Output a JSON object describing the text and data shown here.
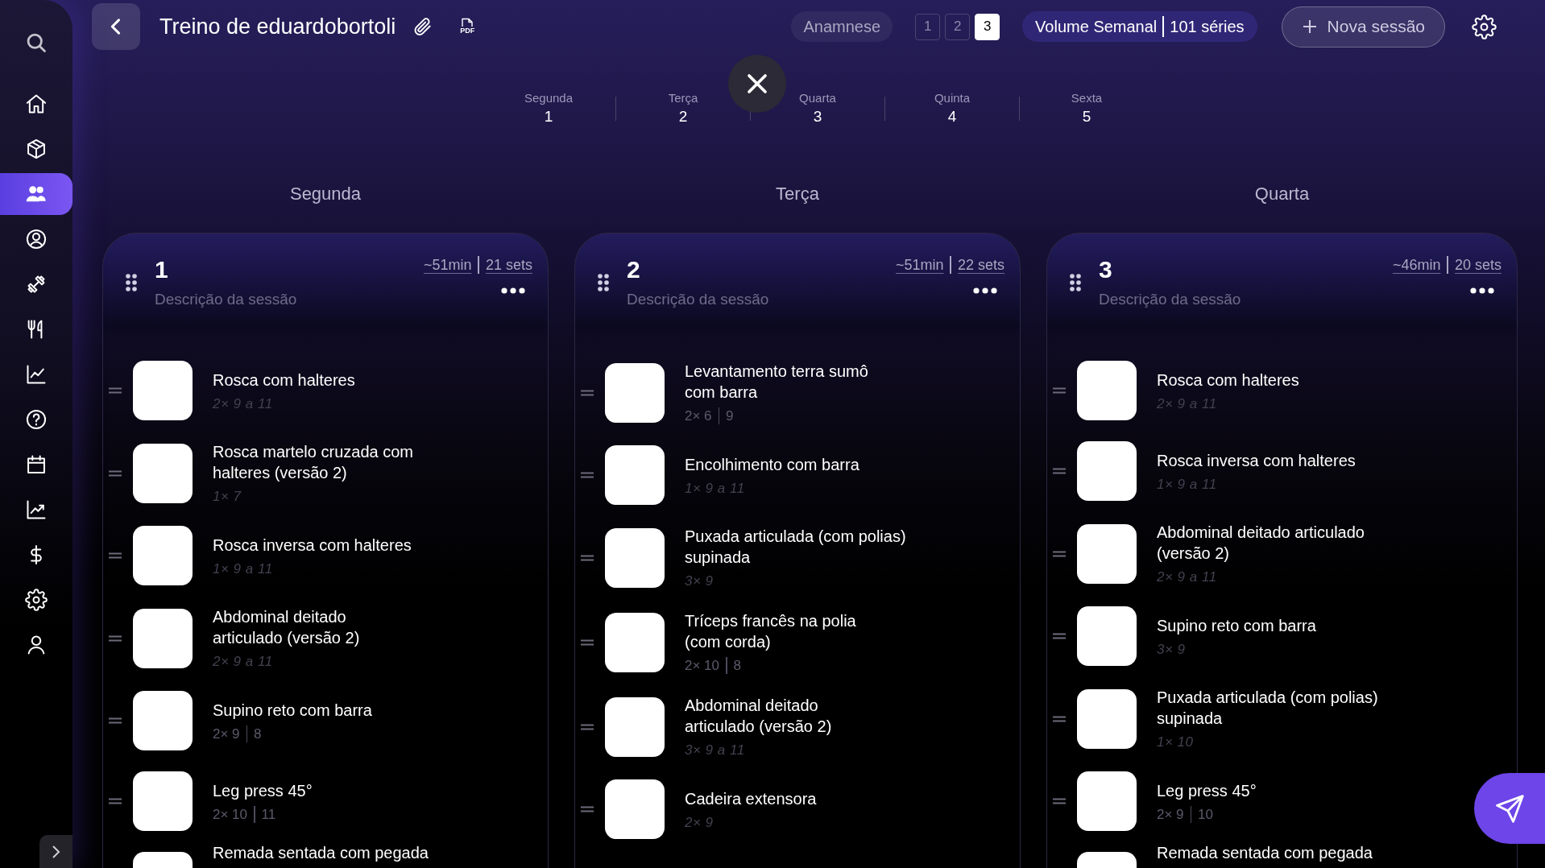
{
  "sidebar": {
    "items": [
      {
        "kind": "search",
        "selected": false
      },
      {
        "kind": "home",
        "selected": false
      },
      {
        "kind": "cube",
        "selected": false
      },
      {
        "kind": "users",
        "selected": true
      },
      {
        "kind": "profile",
        "selected": false
      },
      {
        "kind": "dumbbell",
        "selected": false
      },
      {
        "kind": "utensils",
        "selected": false
      },
      {
        "kind": "chart",
        "selected": false
      },
      {
        "kind": "help",
        "selected": false
      },
      {
        "kind": "calendar",
        "selected": false
      },
      {
        "kind": "trending",
        "selected": false
      },
      {
        "kind": "dollar",
        "selected": false
      },
      {
        "kind": "settings",
        "selected": false
      },
      {
        "kind": "user",
        "selected": false
      }
    ]
  },
  "header": {
    "title": "Treino de eduardobortoli",
    "pdf_label": "PDF",
    "anamnese": "Anamnese",
    "pages": [
      {
        "label": "1",
        "selected": false
      },
      {
        "label": "2",
        "selected": false
      },
      {
        "label": "3",
        "selected": true
      }
    ],
    "volume": {
      "label": "Volume Semanal",
      "value": "101 séries"
    },
    "new_session": "Nova sessão"
  },
  "day_tabs": [
    {
      "day": "Segunda",
      "number": "1"
    },
    {
      "day": "Terça",
      "number": "2"
    },
    {
      "day": "Quarta",
      "number": "3"
    },
    {
      "day": "Quinta",
      "number": "4"
    },
    {
      "day": "Sexta",
      "number": "5"
    }
  ],
  "columns": [
    {
      "day": "Segunda",
      "session": {
        "number": "1",
        "placeholder": "Descrição da sessão",
        "duration": "~51min",
        "sets": "21 sets"
      },
      "exercises": [
        {
          "name": "Rosca com halteres",
          "kind": "range",
          "sets": [
            "2× 9 a 11"
          ]
        },
        {
          "name": "Rosca martelo cruzada com\nhalteres (versão 2)",
          "kind": "range",
          "sets": [
            "1× 7"
          ]
        },
        {
          "name": "Rosca inversa com halteres",
          "kind": "range",
          "sets": [
            "1× 9 a 11"
          ]
        },
        {
          "name": "Abdominal deitado\narticulado (versão 2)",
          "kind": "range",
          "sets": [
            "2× 9 a 11"
          ]
        },
        {
          "name": "Supino reto com barra",
          "kind": "split",
          "sets": [
            "2× 9",
            "8"
          ]
        },
        {
          "name": "Leg press 45°",
          "kind": "split",
          "sets": [
            "2× 10",
            "11"
          ]
        },
        {
          "name": "Remada sentada com pegada"
        }
      ]
    },
    {
      "day": "Terça",
      "session": {
        "number": "2",
        "placeholder": "Descrição da sessão",
        "duration": "~51min",
        "sets": "22 sets"
      },
      "exercises": [
        {
          "name": "Levantamento terra sumô\ncom barra",
          "kind": "split",
          "sets": [
            "2× 6",
            "9"
          ]
        },
        {
          "name": "Encolhimento com barra",
          "kind": "range",
          "sets": [
            "1× 9 a 11"
          ]
        },
        {
          "name": "Puxada articulada (com polias)\nsupinada",
          "kind": "range",
          "sets": [
            "3× 9"
          ]
        },
        {
          "name": "Tríceps francês na polia\n(com corda)",
          "kind": "split",
          "sets": [
            "2× 10",
            "8"
          ]
        },
        {
          "name": "Abdominal deitado\narticulado (versão 2)",
          "kind": "range",
          "sets": [
            "3× 9 a 11"
          ]
        },
        {
          "name": "Cadeira extensora",
          "kind": "range",
          "sets": [
            "2× 9"
          ]
        }
      ]
    },
    {
      "day": "Quarta",
      "session": {
        "number": "3",
        "placeholder": "Descrição da sessão",
        "duration": "~46min",
        "sets": "20 sets"
      },
      "exercises": [
        {
          "name": "Rosca com halteres",
          "kind": "range",
          "sets": [
            "2× 9 a 11"
          ]
        },
        {
          "name": "Rosca inversa com halteres",
          "kind": "range",
          "sets": [
            "1× 9 a 11"
          ]
        },
        {
          "name": "Abdominal deitado articulado\n(versão 2)",
          "kind": "range",
          "sets": [
            "2× 9 a 11"
          ]
        },
        {
          "name": "Supino reto com barra",
          "kind": "range",
          "sets": [
            "3× 9"
          ]
        },
        {
          "name": "Puxada articulada (com polias)\nsupinada",
          "kind": "range",
          "sets": [
            "1× 10"
          ]
        },
        {
          "name": "Leg press 45°",
          "kind": "split",
          "sets": [
            "2× 9",
            "10"
          ]
        },
        {
          "name": "Remada sentada com pegada"
        }
      ]
    }
  ]
}
